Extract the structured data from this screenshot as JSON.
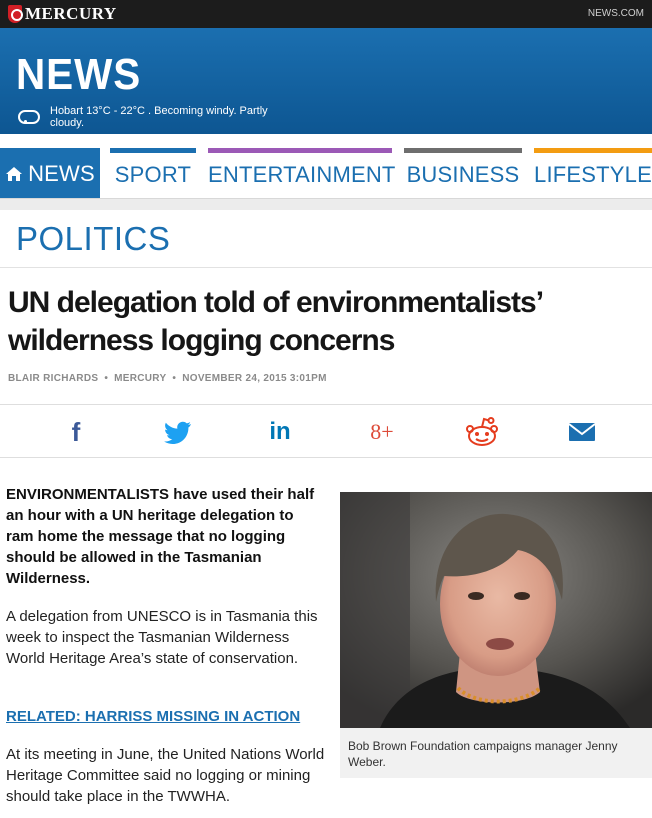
{
  "topbar": {
    "brand": "MERCURY",
    "site": "NEWS.COM"
  },
  "header": {
    "title": "NEWS",
    "weather": "Hobart 13°C - 22°C . Becoming windy. Partly cloudy."
  },
  "nav": {
    "items": [
      {
        "label": "NEWS",
        "color": "#1b6fb0",
        "active": true
      },
      {
        "label": "SPORT",
        "color": "#1b6fb0",
        "active": false
      },
      {
        "label": "ENTERTAINMENT",
        "color": "#9b59b6",
        "active": false
      },
      {
        "label": "BUSINESS",
        "color": "#6e6e6e",
        "active": false
      },
      {
        "label": "LIFESTYLE",
        "color": "#f39c12",
        "active": false
      }
    ]
  },
  "section": {
    "title": "POLITICS"
  },
  "article": {
    "headline": "UN delegation told of environmentalists’ wilderness logging concerns",
    "author": "BLAIR RICHARDS",
    "source": "MERCURY",
    "date": "NOVEMBER 24, 2015 3:01PM",
    "lede_strong": "ENVIRONMENTALISTS",
    "lede_rest": " have used their half an hour with a UN heritage delegation to ram home the message that no logging should be allowed in the Tasmanian Wilderness.",
    "paragraph1": "A delegation from UNESCO is in Tasmania this week to inspect the Tasmanian Wilderness World Heritage Area’s state of conservation.",
    "related": "RELATED: HARRISS MISSING IN ACTION",
    "paragraph2": "At its meeting in June, the United Nations World Heritage Committee said no logging or mining should take place in the TWWHA.",
    "photo_caption": "Bob Brown Foundation campaigns manager Jenny Weber."
  },
  "share": {
    "facebook_glyph": "f",
    "linkedin_glyph": "in",
    "googleplus_glyph": "8+",
    "colors": {
      "facebook": "#3b5998",
      "twitter": "#1da1f2",
      "linkedin": "#0077b5",
      "googleplus": "#dd4b39",
      "reddit": "#e53c1e",
      "email": "#1b6fb0"
    }
  }
}
